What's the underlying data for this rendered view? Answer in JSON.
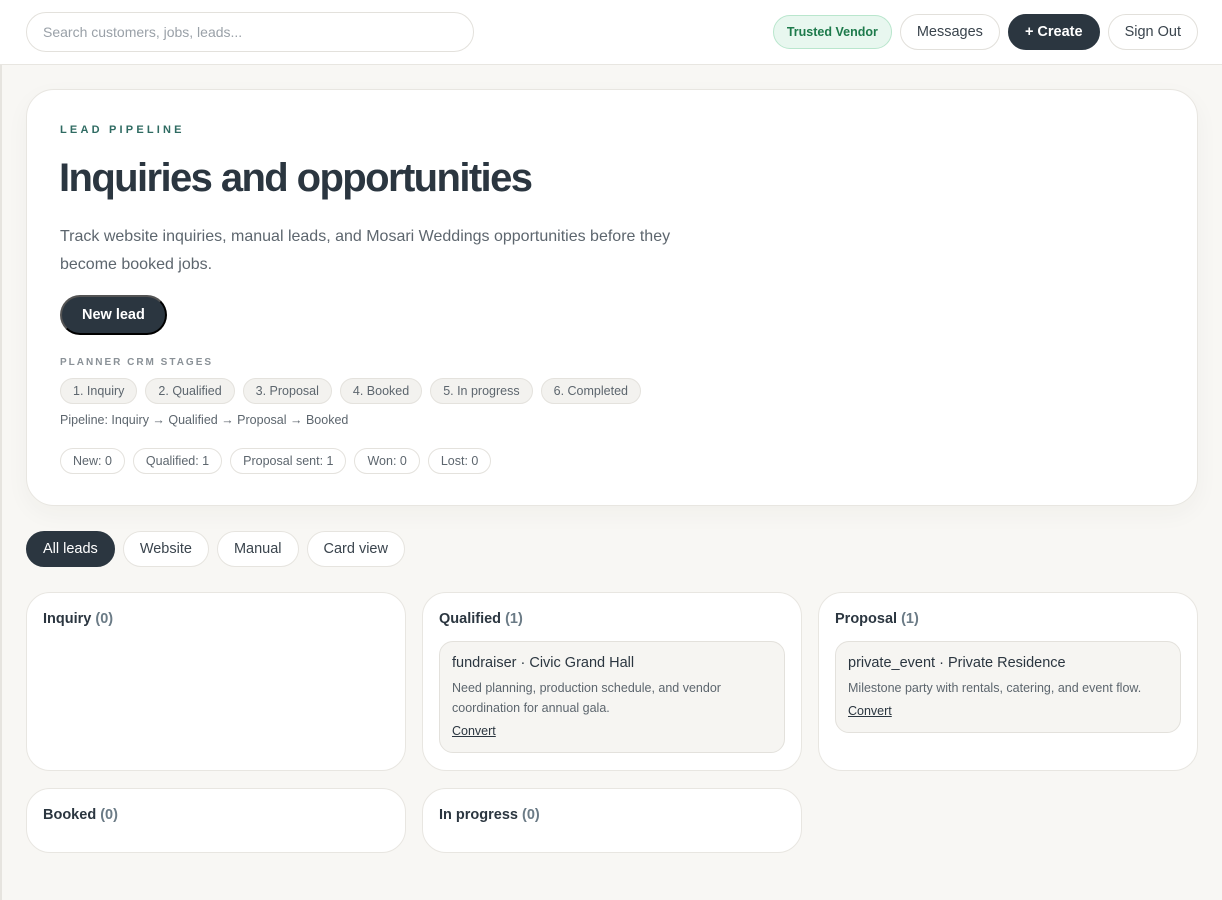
{
  "topbar": {
    "search_placeholder": "Search customers, jobs, leads...",
    "badge": "Trusted Vendor",
    "messages": "Messages",
    "create": "+ Create",
    "signout": "Sign Out"
  },
  "hero": {
    "eyebrow": "LEAD PIPELINE",
    "title": "Inquiries and opportunities",
    "description": "Track website inquiries, manual leads, and Mosari Weddings opportunities before they become booked jobs.",
    "new_lead": "New lead",
    "stages_label": "PLANNER CRM STAGES",
    "stages": [
      "1. Inquiry",
      "2. Qualified",
      "3. Proposal",
      "4. Booked",
      "5. In progress",
      "6. Completed"
    ],
    "pipeline": "Pipeline: Inquiry → Qualified → Proposal → Booked",
    "counts": [
      "New: 0",
      "Qualified: 1",
      "Proposal sent: 1",
      "Won: 0",
      "Lost: 0"
    ]
  },
  "filters": [
    "All leads",
    "Website",
    "Manual",
    "Card view"
  ],
  "columns": [
    {
      "name": "Inquiry",
      "count": "(0)"
    },
    {
      "name": "Qualified",
      "count": "(1)",
      "card": {
        "title": "fundraiser · Civic Grand Hall",
        "desc": "Need planning, production schedule, and vendor coordination for annual gala.",
        "link": "Convert"
      }
    },
    {
      "name": "Proposal",
      "count": "(1)",
      "card": {
        "title": "private_event · Private Residence",
        "desc": "Milestone party with rentals, catering, and event flow.",
        "link": "Convert"
      }
    },
    {
      "name": "Booked",
      "count": "(0)"
    },
    {
      "name": "In progress",
      "count": "(0)"
    }
  ],
  "colors": {
    "primary_dark": "#2b3640",
    "accent_green": "#1d7a4b",
    "eyebrow": "#2f6b62"
  }
}
